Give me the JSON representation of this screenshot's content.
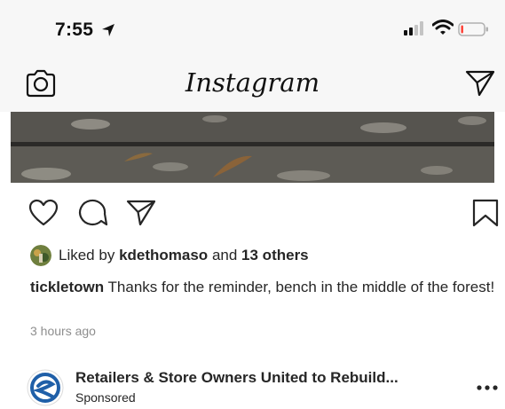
{
  "status_bar": {
    "time": "7:55",
    "location_icon": "location-arrow-icon",
    "signal_icon": "cellular-signal-icon",
    "wifi_icon": "wifi-icon",
    "battery_icon": "battery-low-icon",
    "battery_level": 0.1,
    "battery_color": "#ff3b30"
  },
  "header": {
    "title": "Instagram",
    "left_icon": "camera-icon",
    "right_icon": "direct-message-icon"
  },
  "post": {
    "actions": [
      "heart-icon",
      "comment-icon",
      "share-icon",
      "bookmark-icon"
    ],
    "liked_by_prefix": "Liked by",
    "liked_by_user": "kdethomaso",
    "liked_by_joiner": "and",
    "liked_by_others": "13 others",
    "caption_user": "tickletown",
    "caption_text": "Thanks for the reminder, bench in the middle of the forest!",
    "timestamp": "3 hours ago"
  },
  "sponsored_post": {
    "account_name": "Retailers & Store Owners United to Rebuild...",
    "subtitle": "Sponsored",
    "brand_color": "#1f5fa8",
    "more_icon": "more-options-icon"
  }
}
